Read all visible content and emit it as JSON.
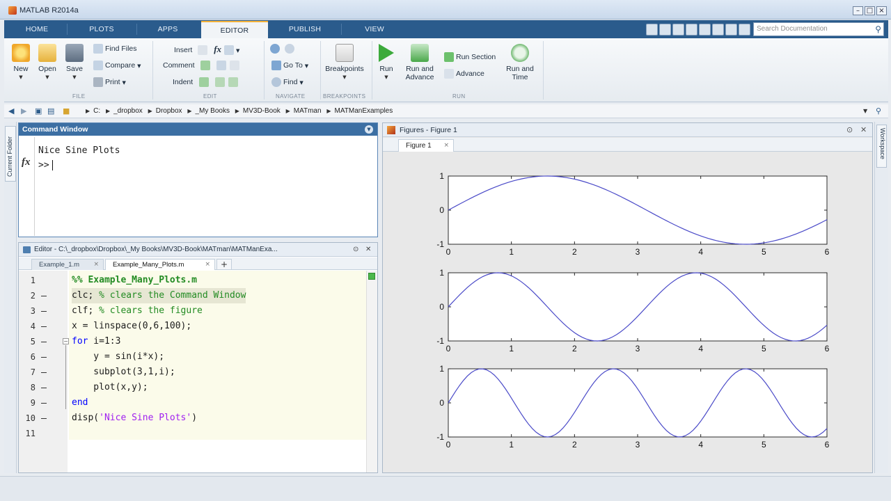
{
  "window": {
    "title": "MATLAB R2014a"
  },
  "ribbon_tabs": [
    "HOME",
    "PLOTS",
    "APPS",
    "EDITOR",
    "PUBLISH",
    "VIEW"
  ],
  "active_tab": "EDITOR",
  "search": {
    "placeholder": "Search Documentation"
  },
  "toolstrip": {
    "file": {
      "new": "New",
      "open": "Open",
      "save": "Save",
      "find_files": "Find Files",
      "compare": "Compare",
      "print": "Print",
      "section": "FILE"
    },
    "edit": {
      "insert": "Insert",
      "comment": "Comment",
      "indent": "Indent",
      "fx_label": "fx",
      "section": "EDIT"
    },
    "navigate": {
      "go_to": "Go To",
      "find": "Find",
      "section": "NAVIGATE"
    },
    "breakpoints": {
      "label": "Breakpoints",
      "section": "BREAKPOINTS"
    },
    "run": {
      "run": "Run",
      "run_advance_1": "Run and",
      "run_advance_2": "Advance",
      "run_section": "Run Section",
      "advance": "Advance",
      "run_time_1": "Run and",
      "run_time_2": "Time",
      "section": "RUN"
    }
  },
  "breadcrumbs": [
    "C:",
    "_dropbox",
    "Dropbox",
    "_My Books",
    "MV3D-Book",
    "MATman",
    "MATManExamples"
  ],
  "side_tabs": {
    "left": "Current Folder",
    "right": "Workspace"
  },
  "command_window": {
    "title": "Command Window",
    "fx_label": "fx",
    "output_line": "Nice Sine Plots",
    "prompt": ">>"
  },
  "editor": {
    "title": "Editor - C:\\_dropbox\\Dropbox\\_My Books\\MV3D-Book\\MATman\\MATManExa...",
    "tabs": [
      {
        "label": "Example_1.m",
        "active": false
      },
      {
        "label": "Example_Many_Plots.m",
        "active": true
      }
    ],
    "add_tab": "+",
    "lines": [
      {
        "num": "1",
        "parts": [
          [
            "cellhead",
            "%% Example_Many_Plots.m"
          ]
        ]
      },
      {
        "num": "2",
        "parts": [
          [
            "plain",
            "clc; "
          ],
          [
            "c",
            "% clears the Command Window"
          ]
        ]
      },
      {
        "num": "3",
        "parts": [
          [
            "plain",
            "clf; "
          ],
          [
            "c",
            "% clears the figure"
          ]
        ]
      },
      {
        "num": "4",
        "parts": [
          [
            "plain",
            "x = linspace(0,6,100);"
          ]
        ]
      },
      {
        "num": "5",
        "parts": [
          [
            "k",
            "for"
          ],
          [
            "plain",
            " i=1:3"
          ]
        ]
      },
      {
        "num": "6",
        "parts": [
          [
            "plain",
            "    y = sin(i*x);"
          ]
        ]
      },
      {
        "num": "7",
        "parts": [
          [
            "plain",
            "    subplot(3,1,i);"
          ]
        ]
      },
      {
        "num": "8",
        "parts": [
          [
            "plain",
            "    plot(x,y);"
          ]
        ]
      },
      {
        "num": "9",
        "parts": [
          [
            "k",
            "end"
          ]
        ]
      },
      {
        "num": "10",
        "parts": [
          [
            "plain",
            "disp("
          ],
          [
            "s",
            "'Nice Sine Plots'"
          ],
          [
            "plain",
            ")"
          ]
        ]
      },
      {
        "num": "11",
        "parts": []
      }
    ]
  },
  "figure_panel": {
    "title": "Figures - Figure 1",
    "tab": "Figure 1"
  },
  "chart_data": [
    {
      "type": "line",
      "title": "",
      "x_range": [
        0,
        6
      ],
      "ylim": [
        -1,
        1
      ],
      "x_ticks": [
        "0",
        "1",
        "2",
        "3",
        "4",
        "5",
        "6"
      ],
      "y_ticks": [
        "-1",
        "0",
        "1"
      ],
      "function": "y = sin(1*x)",
      "frequency": 1,
      "samples": 100,
      "line_color": "#4a4ac8"
    },
    {
      "type": "line",
      "title": "",
      "x_range": [
        0,
        6
      ],
      "ylim": [
        -1,
        1
      ],
      "x_ticks": [
        "0",
        "1",
        "2",
        "3",
        "4",
        "5",
        "6"
      ],
      "y_ticks": [
        "-1",
        "0",
        "1"
      ],
      "function": "y = sin(2*x)",
      "frequency": 2,
      "samples": 100,
      "line_color": "#4a4ac8"
    },
    {
      "type": "line",
      "title": "",
      "x_range": [
        0,
        6
      ],
      "ylim": [
        -1,
        1
      ],
      "x_ticks": [
        "0",
        "1",
        "2",
        "3",
        "4",
        "5",
        "6"
      ],
      "y_ticks": [
        "-1",
        "0",
        "1"
      ],
      "function": "y = sin(3*x)",
      "frequency": 3,
      "samples": 100,
      "line_color": "#4a4ac8"
    }
  ]
}
